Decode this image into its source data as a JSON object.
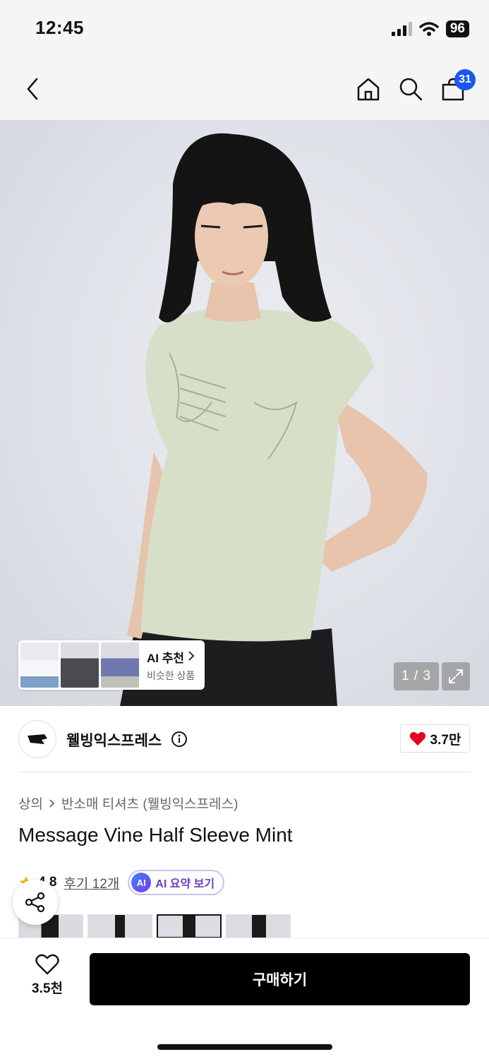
{
  "status_bar": {
    "time": "12:45",
    "battery": "96"
  },
  "nav": {
    "cart_count": "31"
  },
  "gallery": {
    "counter": "1 / 3",
    "ai_rec_title": "AI 추천",
    "ai_rec_subtitle": "비슷한 상품"
  },
  "brand": {
    "name": "웰빙익스프레스",
    "likes": "3.7만"
  },
  "breadcrumb": {
    "category": "상의",
    "subcategory": "반소매 티셔츠 (웰빙익스프레스)"
  },
  "product": {
    "title": "Message Vine Half Sleeve Mint",
    "rating": "4.8",
    "reviews": "후기 12개",
    "ai_summary_badge": "AI",
    "ai_summary": "AI 요약 보기"
  },
  "bottom_bar": {
    "wish_count": "3.5천",
    "buy_label": "구매하기"
  },
  "colors": {
    "accent_blue": "#1a56f0",
    "heart_red": "#e60023",
    "ai_purple": "#6a3fc4"
  }
}
